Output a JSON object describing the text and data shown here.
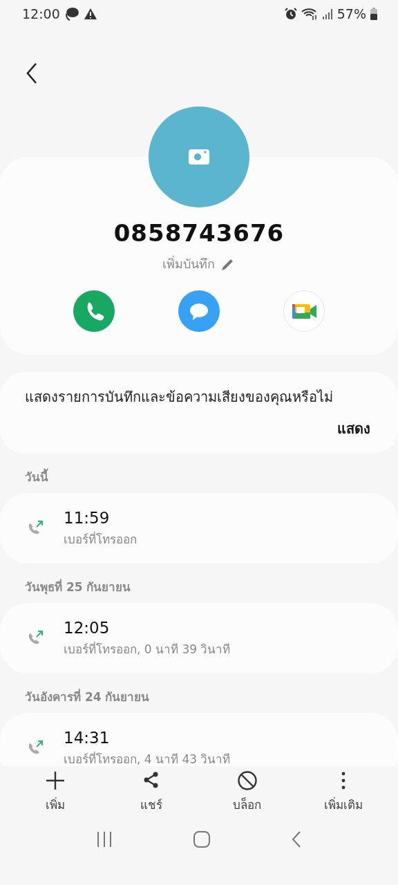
{
  "status_bar": {
    "time": "12:00",
    "battery": "57%"
  },
  "contact": {
    "name": "0858743676",
    "note_label": "เพิ่มบันทึก"
  },
  "actions": [
    {
      "kind": "call"
    },
    {
      "kind": "message"
    },
    {
      "kind": "video"
    }
  ],
  "banner": {
    "text": "แสดงรายการบันทึกและข้อความเสียงของคุณหรือไม่",
    "button": "แสดง"
  },
  "call_log": [
    {
      "date": "วันนี้",
      "entries": [
        {
          "kind": "outgoing",
          "time": "11:59",
          "detail": "เบอร์ที่โทรออก"
        }
      ]
    },
    {
      "date": "วันพุธที่ 25 กันยายน",
      "entries": [
        {
          "kind": "outgoing",
          "time": "12:05",
          "detail": "เบอร์ที่โทรออก, 0 นาที 39 วินาที"
        }
      ]
    },
    {
      "date": "วันอังคารที่ 24 กันยายน",
      "entries": [
        {
          "kind": "outgoing",
          "time": "14:31",
          "detail": "เบอร์ที่โทรออก, 4 นาที 43 วินาที"
        }
      ]
    }
  ],
  "toolbar": [
    {
      "kind": "add",
      "label": "เพิ่ม"
    },
    {
      "kind": "share",
      "label": "แชร์"
    },
    {
      "kind": "block",
      "label": "บล็อก"
    },
    {
      "kind": "more",
      "label": "เพิ่มเติม"
    }
  ]
}
